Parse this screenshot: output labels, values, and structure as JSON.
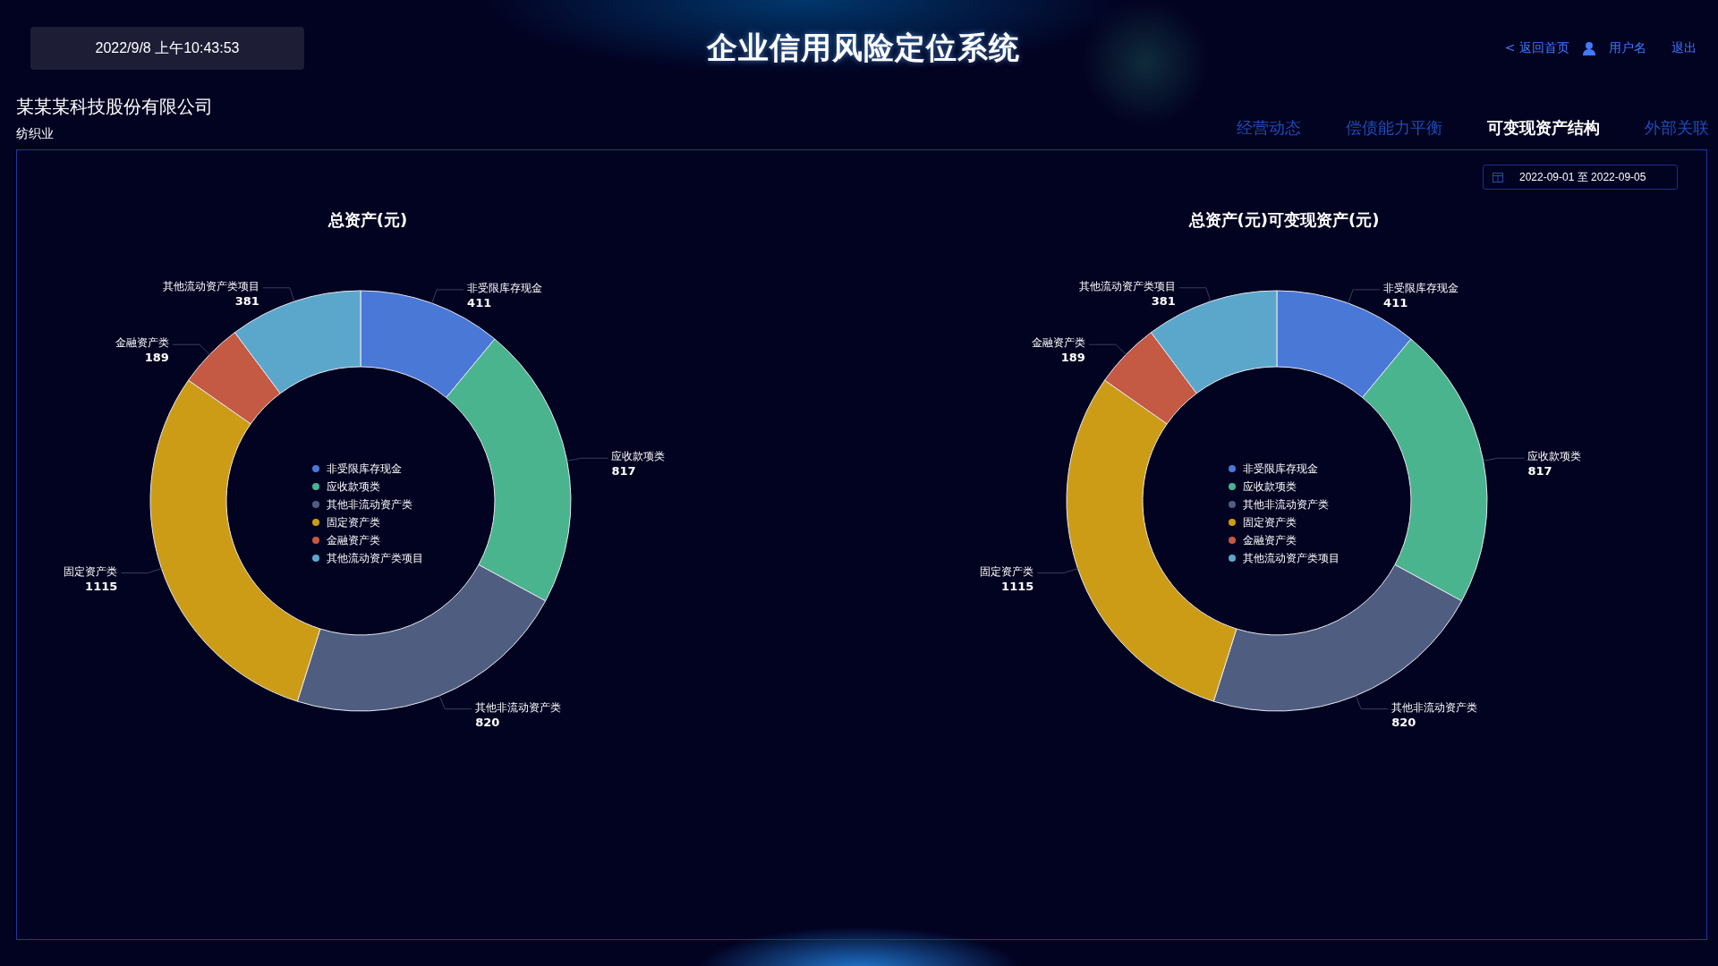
{
  "header": {
    "datetime": "2022/9/8 上午10:43:53",
    "title": "企业信用风险定位系统",
    "links": [
      {
        "kind": "back",
        "label": "< 返回首页"
      },
      {
        "kind": "user",
        "label": "用户名"
      },
      {
        "kind": "logout",
        "label": "退出"
      }
    ]
  },
  "company": {
    "name": "某某某科技股份有限公司",
    "industry": "纺织业"
  },
  "tabs": [
    {
      "label": "经营动态",
      "selected": false
    },
    {
      "label": "偿债能力平衡",
      "selected": false
    },
    {
      "label": "可变现资产结构",
      "selected": true
    },
    {
      "label": "外部关联",
      "selected": false
    }
  ],
  "date_range": {
    "start": "2022-09-01",
    "separator": "至",
    "end": "2022-09-05"
  },
  "charts": [
    {
      "chart_data": {
        "type": "donut",
        "title": "总资产(元)",
        "categories": [
          "非受限库存现金",
          "应收款项类",
          "其他非流动资产类",
          "固定资产类",
          "金融资产类",
          "其他流动资产类项目"
        ],
        "values": [
          411,
          817,
          820,
          1115,
          189,
          381
        ],
        "data_labels": true
      },
      "legend": [
        {
          "label": "非受限库存现金",
          "color": "#4a78d6"
        },
        {
          "label": "应收款项类",
          "color": "#4ab48f"
        },
        {
          "label": "其他非流动资产类",
          "color": "#4f5e80"
        },
        {
          "label": "固定资产类",
          "color": "#cd9c17"
        },
        {
          "label": "金融资产类",
          "color": "#c45944"
        },
        {
          "label": "其他流动资产类项目",
          "color": "#5ba7cb"
        }
      ]
    },
    {
      "chart_data": {
        "type": "donut",
        "title": "总资产(元)可变现资产(元)",
        "categories": [
          "非受限库存现金",
          "应收款项类",
          "其他非流动资产类",
          "固定资产类",
          "金融资产类",
          "其他流动资产类项目"
        ],
        "values": [
          411,
          817,
          820,
          1115,
          189,
          381
        ],
        "data_labels": true
      },
      "legend": [
        {
          "label": "非受限库存现金",
          "color": "#4a78d6"
        },
        {
          "label": "应收款项类",
          "color": "#4ab48f"
        },
        {
          "label": "其他非流动资产类",
          "color": "#4f5e80"
        },
        {
          "label": "固定资产类",
          "color": "#cd9c17"
        },
        {
          "label": "金融资产类",
          "color": "#c45944"
        },
        {
          "label": "其他流动资产类项目",
          "color": "#5ba7cb"
        }
      ]
    }
  ]
}
